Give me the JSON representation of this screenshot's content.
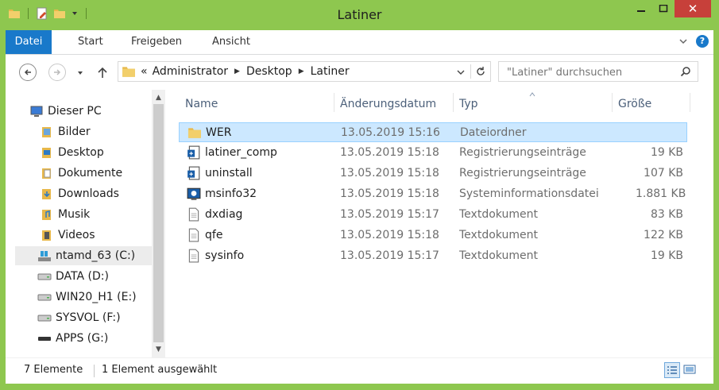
{
  "window": {
    "title": "Latiner",
    "minimize": "—",
    "maximize": "☐",
    "close": "✕"
  },
  "ribbon": {
    "tabs": [
      "Datei",
      "Start",
      "Freigeben",
      "Ansicht"
    ],
    "help": "?"
  },
  "nav": {
    "breadcrumb": [
      "«",
      "Administrator",
      "Desktop",
      "Latiner"
    ],
    "search_placeholder": "\"Latiner\" durchsuchen"
  },
  "tree": [
    {
      "label": "Dieser PC",
      "icon": "pc-icon"
    },
    {
      "label": "Bilder",
      "icon": "pictures-folder-icon"
    },
    {
      "label": "Desktop",
      "icon": "desktop-folder-icon"
    },
    {
      "label": "Dokumente",
      "icon": "documents-folder-icon"
    },
    {
      "label": "Downloads",
      "icon": "downloads-folder-icon"
    },
    {
      "label": "Musik",
      "icon": "music-folder-icon"
    },
    {
      "label": "Videos",
      "icon": "videos-folder-icon"
    },
    {
      "label": "ntamd_63 (C:)",
      "icon": "system-drive-icon"
    },
    {
      "label": "DATA (D:)",
      "icon": "drive-icon"
    },
    {
      "label": "WIN20_H1 (E:)",
      "icon": "drive-icon"
    },
    {
      "label": "SYSVOL (F:)",
      "icon": "drive-icon"
    },
    {
      "label": "APPS (G:)",
      "icon": "drive-icon"
    }
  ],
  "columns": {
    "name": "Name",
    "date": "Änderungsdatum",
    "type": "Typ",
    "size": "Größe"
  },
  "files": [
    {
      "name": "WER",
      "date": "13.05.2019 15:16",
      "type": "Dateiordner",
      "size": "",
      "icon": "folder-icon"
    },
    {
      "name": "latiner_comp",
      "date": "13.05.2019 15:18",
      "type": "Registrierungseinträge",
      "size": "19 KB",
      "icon": "registry-file-icon"
    },
    {
      "name": "uninstall",
      "date": "13.05.2019 15:18",
      "type": "Registrierungseinträge",
      "size": "107 KB",
      "icon": "registry-file-icon"
    },
    {
      "name": "msinfo32",
      "date": "13.05.2019 15:18",
      "type": "Systeminformationsdatei",
      "size": "1.881 KB",
      "icon": "sysinfo-file-icon"
    },
    {
      "name": "dxdiag",
      "date": "13.05.2019 15:17",
      "type": "Textdokument",
      "size": "83 KB",
      "icon": "text-file-icon"
    },
    {
      "name": "qfe",
      "date": "13.05.2019 15:18",
      "type": "Textdokument",
      "size": "122 KB",
      "icon": "text-file-icon"
    },
    {
      "name": "sysinfo",
      "date": "13.05.2019 15:17",
      "type": "Textdokument",
      "size": "19 KB",
      "icon": "text-file-icon"
    }
  ],
  "status": {
    "count": "7 Elemente",
    "selection": "1 Element ausgewählt"
  },
  "colors": {
    "titlebar": "#8ec74f",
    "accent": "#1979ca",
    "close": "#c7403a",
    "selection": "#cce8ff"
  }
}
